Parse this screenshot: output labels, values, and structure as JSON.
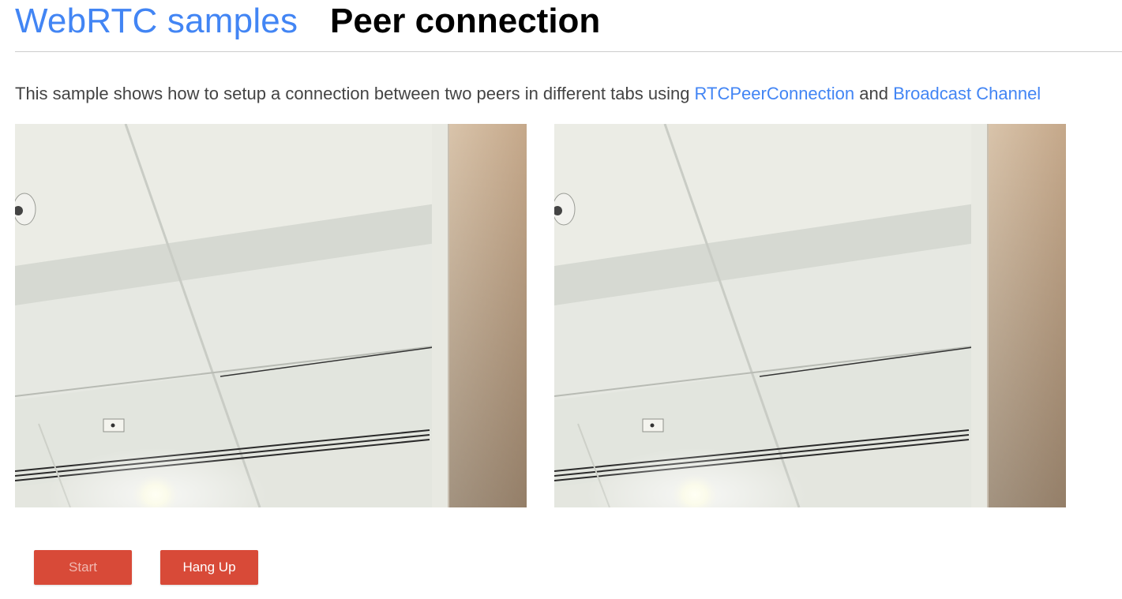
{
  "header": {
    "site_title": "WebRTC samples",
    "page_title": "Peer connection"
  },
  "description": {
    "text_before": "This sample shows how to setup a connection between two peers in different tabs using ",
    "link1": "RTCPeerConnection",
    "text_between": " and ",
    "link2": "Broadcast Channel"
  },
  "videos": {
    "local": "camera view of office ceiling",
    "remote": "camera view of office ceiling"
  },
  "buttons": {
    "start_label": "Start",
    "start_disabled": true,
    "hangup_label": "Hang Up",
    "hangup_disabled": false
  },
  "colors": {
    "link": "#4285f4",
    "button_bg": "#d84a38",
    "text": "#444444"
  }
}
